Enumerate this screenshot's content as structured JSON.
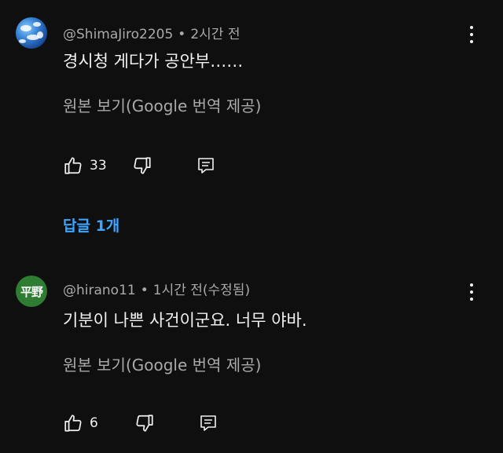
{
  "comments": [
    {
      "handle": "@ShimaJiro2205",
      "separator": "•",
      "time": "2시간 전",
      "text": "경시청 게다가 공안부……",
      "translate_label": "원본 보기(Google 번역 제공)",
      "likes": "33",
      "replies_label": "답글 1개"
    },
    {
      "avatar_text": "平野",
      "handle": "@hirano11",
      "separator": "•",
      "time": "1시간 전(수정됨)",
      "text": "기분이 나쁜 사건이군요. 너무 야바.",
      "translate_label": "원본 보기(Google 번역 제공)",
      "likes": "6"
    }
  ],
  "colors": {
    "background": "#0f0f0f",
    "link": "#3ea6ff",
    "secondary_text": "#aaaaaa",
    "avatar_green": "#2e7d32"
  },
  "icons": [
    "like-icon",
    "dislike-icon",
    "reply-icon",
    "more-icon"
  ]
}
